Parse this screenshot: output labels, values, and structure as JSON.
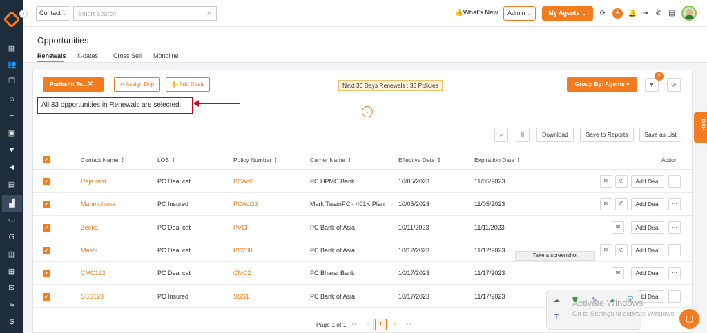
{
  "topbar": {
    "contact_select": "Contact",
    "search_placeholder": "Smart Search",
    "whats_new": "What's New",
    "admin_select": "Admin",
    "my_agents": "My Agents"
  },
  "page": {
    "title": "Opportunities",
    "tabs": [
      "Renewals",
      "X-dates",
      "Cross Sell",
      "Monoline"
    ]
  },
  "filters": {
    "chip_label": "Parikshit Te...",
    "assign_drip": "Assign Drip",
    "add_deals": "Add Deals",
    "renewals_badge": "Next 30 Days Renewals : 33 Policies",
    "group_by": "Group By: Agents",
    "filter_count": "2"
  },
  "selection_message": "All 33 opportunities in Renewals are selected.",
  "toolbar": {
    "download": "Download",
    "save_to_reports": "Save to Reports",
    "save_as_list": "Save as List"
  },
  "help_label": "Help",
  "table": {
    "columns": [
      "Contact Name",
      "LOB",
      "Policy Number",
      "Carrier Name",
      "Effective Date",
      "Expiration Date",
      "Action"
    ],
    "add_deal_label": "Add Deal",
    "rows": [
      {
        "contact": "Raja ram",
        "lob": "PC Deal cat",
        "policy": "PCAct1",
        "carrier": "PC HPMC Bank",
        "effective": "10/05/2023",
        "expiration": "11/05/2023"
      },
      {
        "contact": "Manmohana",
        "lob": "PC Insured",
        "policy": "PCAct33",
        "carrier": "Mark TwainPC - 401K Plan",
        "effective": "10/05/2023",
        "expiration": "11/05/2023"
      },
      {
        "contact": "Zeeka",
        "lob": "PC Deal cat",
        "policy": "PVCF",
        "carrier": "PC Bank of Asia",
        "effective": "10/11/2023",
        "expiration": "11/11/2023"
      },
      {
        "contact": "Mashi",
        "lob": "PC Deal cat",
        "policy": "PC200",
        "carrier": "PC Bank of Asia",
        "effective": "10/12/2023",
        "expiration": "11/12/2023"
      },
      {
        "contact": "CMC123",
        "lob": "PC Deal cat",
        "policy": "CMC2",
        "carrier": "PC Bharat Bank",
        "effective": "10/17/2023",
        "expiration": "11/17/2023"
      },
      {
        "contact": "SSS123",
        "lob": "PC Insured",
        "policy": "SSS1",
        "carrier": "PC Bank of Asia",
        "effective": "10/17/2023",
        "expiration": "11/17/2023"
      }
    ]
  },
  "pager": {
    "text": "Page 1 of 1",
    "first": "««",
    "prev": "«",
    "current": "1",
    "next": "»",
    "last": "»»"
  },
  "tooltip": "Take a screenshot",
  "watermark": {
    "line1": "Activate Windows",
    "line2": "Go to Settings to activate Windows."
  },
  "colors": {
    "accent": "#f47c20",
    "sidebar": "#1e2d3b",
    "annotation_red": "#d0021b"
  }
}
